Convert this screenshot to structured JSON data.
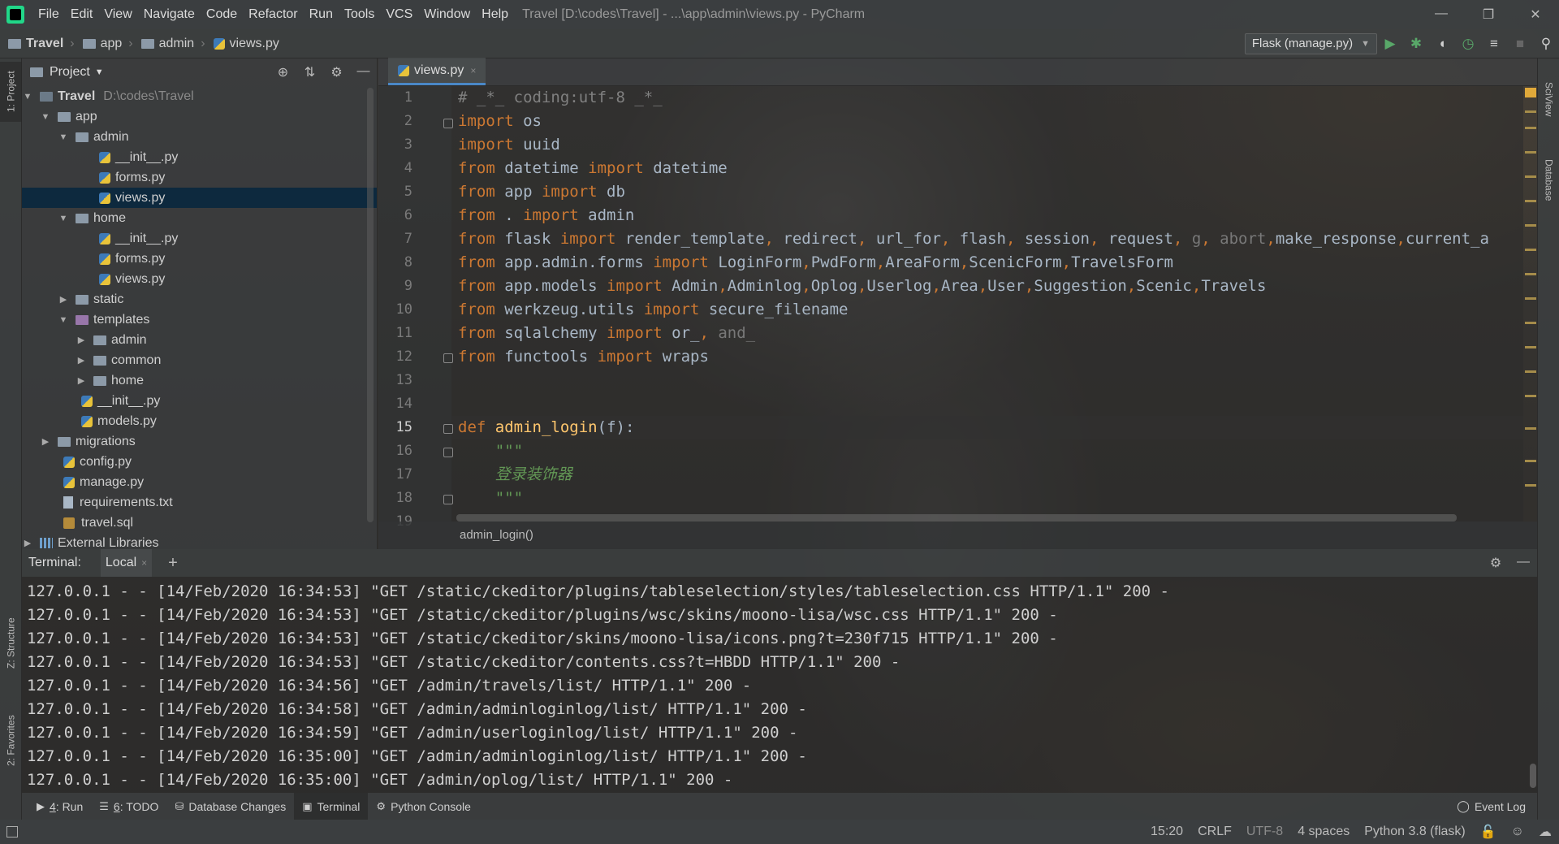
{
  "menu": {
    "items": [
      "File",
      "Edit",
      "View",
      "Navigate",
      "Code",
      "Refactor",
      "Run",
      "Tools",
      "VCS",
      "Window",
      "Help"
    ],
    "title": "Travel [D:\\codes\\Travel] - ...\\app\\admin\\views.py - PyCharm"
  },
  "window_controls": {
    "minimize": "—",
    "restore": "❐",
    "close": "✕"
  },
  "breadcrumb": {
    "project": "Travel",
    "folder1": "app",
    "folder2": "admin",
    "file": "views.py"
  },
  "run_config": {
    "label": "Flask (manage.py)"
  },
  "toolbar_icons": {
    "run": "▶",
    "debug": "✱",
    "coverage": "◖",
    "profile": "◷",
    "build": "≡",
    "stop": "■",
    "search": "⚲"
  },
  "left_stripe": {
    "project_tab": "1: Project",
    "structure_tab": "Z: Structure",
    "favorites_tab": "2: Favorites"
  },
  "right_stripe": {
    "sciview_tab": "SciView",
    "database_tab": "Database"
  },
  "project_panel": {
    "title": "Project",
    "icons": {
      "locate": "⊕",
      "collapse": "⇅",
      "settings": "⚙",
      "hide": "—"
    },
    "tree": [
      {
        "label": "Travel",
        "hint": "D:\\codes\\Travel",
        "arrow": "▼"
      },
      {
        "label": "app",
        "arrow": "▼"
      },
      {
        "label": "admin",
        "arrow": "▼"
      },
      {
        "label": "__init__.py"
      },
      {
        "label": "forms.py"
      },
      {
        "label": "views.py"
      },
      {
        "label": "home",
        "arrow": "▼"
      },
      {
        "label": "__init__.py"
      },
      {
        "label": "forms.py"
      },
      {
        "label": "views.py"
      },
      {
        "label": "static",
        "arrow": "▶"
      },
      {
        "label": "templates",
        "arrow": "▼"
      },
      {
        "label": "admin",
        "arrow": "▶"
      },
      {
        "label": "common",
        "arrow": "▶"
      },
      {
        "label": "home",
        "arrow": "▶"
      },
      {
        "label": "__init__.py"
      },
      {
        "label": "models.py"
      },
      {
        "label": "migrations",
        "arrow": "▶"
      },
      {
        "label": "config.py"
      },
      {
        "label": "manage.py"
      },
      {
        "label": "requirements.txt"
      },
      {
        "label": "travel.sql"
      },
      {
        "label": "External Libraries",
        "arrow": "▶"
      }
    ]
  },
  "editor": {
    "tab_label": "views.py",
    "tab_close": "×",
    "line_numbers": [
      "1",
      "2",
      "3",
      "4",
      "5",
      "6",
      "7",
      "8",
      "9",
      "10",
      "11",
      "12",
      "13",
      "14",
      "15",
      "16",
      "17",
      "18",
      "19"
    ],
    "lines": [
      [
        {
          "t": "# _*_ coding:utf-8 _*_",
          "c": "cm"
        }
      ],
      [
        {
          "t": "import",
          "c": "kw"
        },
        {
          "t": " os",
          "c": ""
        }
      ],
      [
        {
          "t": "import",
          "c": "kw"
        },
        {
          "t": " uuid",
          "c": ""
        }
      ],
      [
        {
          "t": "from",
          "c": "kw"
        },
        {
          "t": " datetime ",
          "c": ""
        },
        {
          "t": "import",
          "c": "kw"
        },
        {
          "t": " datetime",
          "c": ""
        }
      ],
      [
        {
          "t": "from",
          "c": "kw"
        },
        {
          "t": " app ",
          "c": ""
        },
        {
          "t": "import",
          "c": "kw"
        },
        {
          "t": " db",
          "c": ""
        }
      ],
      [
        {
          "t": "from",
          "c": "kw"
        },
        {
          "t": " . ",
          "c": ""
        },
        {
          "t": "import",
          "c": "kw"
        },
        {
          "t": " admin",
          "c": ""
        }
      ],
      [
        {
          "t": "from",
          "c": "kw"
        },
        {
          "t": " flask ",
          "c": ""
        },
        {
          "t": "import",
          "c": "kw"
        },
        {
          "t": " render_template",
          "c": ""
        },
        {
          "t": ",",
          "c": "kw"
        },
        {
          "t": " redirect",
          "c": ""
        },
        {
          "t": ",",
          "c": "kw"
        },
        {
          "t": " url_for",
          "c": ""
        },
        {
          "t": ",",
          "c": "kw"
        },
        {
          "t": " flash",
          "c": ""
        },
        {
          "t": ",",
          "c": "kw"
        },
        {
          "t": " session",
          "c": ""
        },
        {
          "t": ",",
          "c": "kw"
        },
        {
          "t": " request",
          "c": ""
        },
        {
          "t": ",",
          "c": "kw"
        },
        {
          "t": " g",
          "c": "gray"
        },
        {
          "t": ",",
          "c": "kw"
        },
        {
          "t": " abort",
          "c": "gray"
        },
        {
          "t": ",",
          "c": "kw"
        },
        {
          "t": "make_response",
          "c": ""
        },
        {
          "t": ",",
          "c": "kw"
        },
        {
          "t": "current_a",
          "c": ""
        }
      ],
      [
        {
          "t": "from",
          "c": "kw"
        },
        {
          "t": " app.admin.forms ",
          "c": ""
        },
        {
          "t": "import",
          "c": "kw"
        },
        {
          "t": " LoginForm",
          "c": ""
        },
        {
          "t": ",",
          "c": "kw"
        },
        {
          "t": "PwdForm",
          "c": ""
        },
        {
          "t": ",",
          "c": "kw"
        },
        {
          "t": "AreaForm",
          "c": ""
        },
        {
          "t": ",",
          "c": "kw"
        },
        {
          "t": "ScenicForm",
          "c": ""
        },
        {
          "t": ",",
          "c": "kw"
        },
        {
          "t": "TravelsForm",
          "c": ""
        }
      ],
      [
        {
          "t": "from",
          "c": "kw"
        },
        {
          "t": " app.models ",
          "c": ""
        },
        {
          "t": "import",
          "c": "kw"
        },
        {
          "t": " Admin",
          "c": ""
        },
        {
          "t": ",",
          "c": "kw"
        },
        {
          "t": "Adminlog",
          "c": ""
        },
        {
          "t": ",",
          "c": "kw"
        },
        {
          "t": "Oplog",
          "c": ""
        },
        {
          "t": ",",
          "c": "kw"
        },
        {
          "t": "Userlog",
          "c": ""
        },
        {
          "t": ",",
          "c": "kw"
        },
        {
          "t": "Area",
          "c": ""
        },
        {
          "t": ",",
          "c": "kw"
        },
        {
          "t": "User",
          "c": ""
        },
        {
          "t": ",",
          "c": "kw"
        },
        {
          "t": "Suggestion",
          "c": ""
        },
        {
          "t": ",",
          "c": "kw"
        },
        {
          "t": "Scenic",
          "c": ""
        },
        {
          "t": ",",
          "c": "kw"
        },
        {
          "t": "Travels",
          "c": ""
        }
      ],
      [
        {
          "t": "from",
          "c": "kw"
        },
        {
          "t": " werkzeug.utils ",
          "c": ""
        },
        {
          "t": "import",
          "c": "kw"
        },
        {
          "t": " secure_filename",
          "c": ""
        }
      ],
      [
        {
          "t": "from",
          "c": "kw"
        },
        {
          "t": " sqlalchemy ",
          "c": ""
        },
        {
          "t": "import",
          "c": "kw"
        },
        {
          "t": " or_",
          "c": ""
        },
        {
          "t": ",",
          "c": "kw"
        },
        {
          "t": " and_",
          "c": "gray"
        }
      ],
      [
        {
          "t": "from",
          "c": "kw"
        },
        {
          "t": " functools ",
          "c": ""
        },
        {
          "t": "import",
          "c": "kw"
        },
        {
          "t": " wraps",
          "c": ""
        }
      ],
      [],
      [],
      [
        {
          "t": "def",
          "c": "kw"
        },
        {
          "t": " ",
          "c": ""
        },
        {
          "t": "admin_login",
          "c": "fn"
        },
        {
          "t": "(f):",
          "c": ""
        }
      ],
      [
        {
          "t": "    \"\"\"",
          "c": "doc"
        }
      ],
      [
        {
          "t": "    登录装饰器",
          "c": "doc"
        }
      ],
      [
        {
          "t": "    \"\"\"",
          "c": "doc"
        }
      ],
      []
    ],
    "current_line": 15,
    "breadcrumb_function": "admin_login()"
  },
  "terminal": {
    "label": "Terminal:",
    "tab": "Local",
    "tab_close": "×",
    "add": "+",
    "settings_icon": "⚙",
    "hide_icon": "—",
    "lines": [
      "127.0.0.1 - - [14/Feb/2020 16:34:53] \"GET /static/ckeditor/plugins/tableselection/styles/tableselection.css HTTP/1.1\" 200 -",
      "127.0.0.1 - - [14/Feb/2020 16:34:53] \"GET /static/ckeditor/plugins/wsc/skins/moono-lisa/wsc.css HTTP/1.1\" 200 -",
      "127.0.0.1 - - [14/Feb/2020 16:34:53] \"GET /static/ckeditor/skins/moono-lisa/icons.png?t=230f715 HTTP/1.1\" 200 -",
      "127.0.0.1 - - [14/Feb/2020 16:34:53] \"GET /static/ckeditor/contents.css?t=HBDD HTTP/1.1\" 200 -",
      "127.0.0.1 - - [14/Feb/2020 16:34:56] \"GET /admin/travels/list/ HTTP/1.1\" 200 -",
      "127.0.0.1 - - [14/Feb/2020 16:34:58] \"GET /admin/adminloginlog/list/ HTTP/1.1\" 200 -",
      "127.0.0.1 - - [14/Feb/2020 16:34:59] \"GET /admin/userloginlog/list/ HTTP/1.1\" 200 -",
      "127.0.0.1 - - [14/Feb/2020 16:35:00] \"GET /admin/adminloginlog/list/ HTTP/1.1\" 200 -",
      "127.0.0.1 - - [14/Feb/2020 16:35:00] \"GET /admin/oplog/list/ HTTP/1.1\" 200 -"
    ]
  },
  "tool_windows": {
    "run": {
      "num": "4",
      "label": ": Run",
      "glyph": "▶"
    },
    "todo": {
      "num": "6",
      "label": ": TODO",
      "glyph": "☰"
    },
    "db_changes": {
      "label": "Database Changes",
      "glyph": "⛁"
    },
    "terminal": {
      "label": "Terminal",
      "glyph": "▣"
    },
    "python_console": {
      "label": "Python Console",
      "glyph": "⚙"
    },
    "event_log": {
      "label": "Event Log",
      "glyph": "◯"
    }
  },
  "status": {
    "position": "15:20",
    "line_sep": "CRLF",
    "encoding": "UTF-8",
    "indent": "4 spaces",
    "interpreter": "Python 3.8 (flask)",
    "lock_icon": "🔓",
    "inspector_icon": "☺",
    "notif_icon": "☁"
  }
}
